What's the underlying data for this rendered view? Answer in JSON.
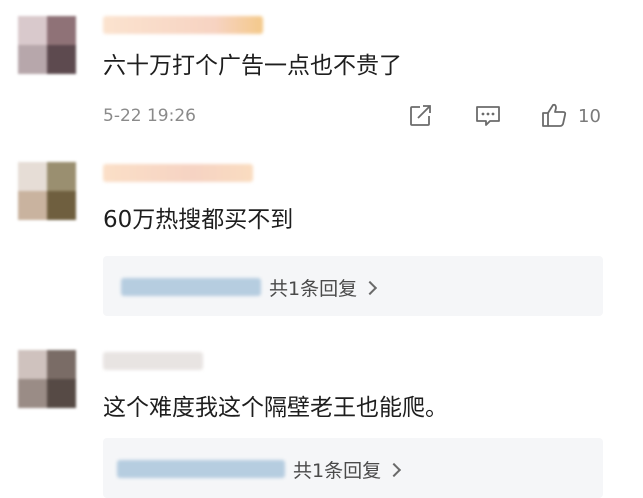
{
  "comments": [
    {
      "text": "六十万打个广告一点也不贵了",
      "timestamp": "5-22 19:26",
      "like_count": "10",
      "icons": [
        "share-icon",
        "comment-icon",
        "like-icon"
      ]
    },
    {
      "text": "60万热搜都买不到",
      "reply_summary": "共1条回复"
    },
    {
      "text": "这个难度我这个隔壁老王也能爬。",
      "reply_summary": "共1条回复"
    }
  ]
}
